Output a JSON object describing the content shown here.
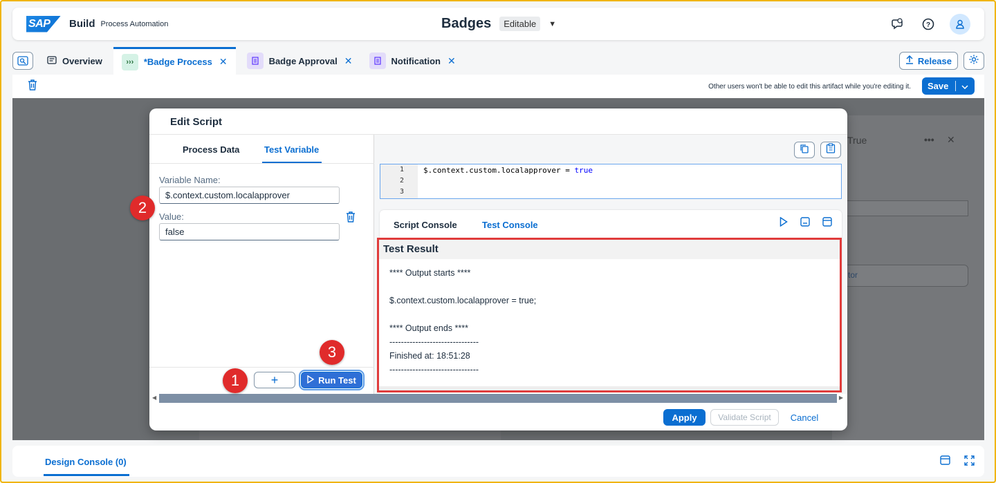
{
  "shell": {
    "logo": "SAP",
    "brand": "Build",
    "product": "Process Automation",
    "title": "Badges",
    "mode": "Editable"
  },
  "tabs": [
    {
      "label": "Overview"
    },
    {
      "label": "*Badge Process"
    },
    {
      "label": "Badge Approval"
    },
    {
      "label": "Notification"
    }
  ],
  "tabbar": {
    "release": "Release"
  },
  "toolbar": {
    "note": "Other users won't be able to edit this artifact while you're editing it.",
    "save": "Save"
  },
  "background": {
    "partial_true": "True",
    "partial_tor": "tor"
  },
  "dialog": {
    "title": "Edit Script",
    "left_tabs": [
      "Process Data",
      "Test Variable"
    ],
    "variable_name_label": "Variable Name:",
    "variable_name_value": "$.context.custom.localapprover",
    "value_label": "Value:",
    "value_value": "false",
    "run_test": "Run Test",
    "add_symbol": "+",
    "editor": {
      "line_numbers": [
        "1",
        "2",
        "3"
      ],
      "code_prefix": "$.context.custom.localapprover = ",
      "code_keyword": "true"
    },
    "console_tabs": [
      "Script Console",
      "Test Console"
    ],
    "test_result": {
      "heading": "Test Result",
      "lines": [
        "**** Output starts ****",
        "",
        "$.context.custom.localapprover = true;",
        "",
        "**** Output ends ****",
        "-------------------------------",
        "Finished at: 18:51:28",
        "-------------------------------"
      ]
    },
    "footer": {
      "apply": "Apply",
      "validate": "Validate Script",
      "cancel": "Cancel"
    }
  },
  "markers": [
    "1",
    "2",
    "3"
  ],
  "bottom": {
    "design_console": "Design Console (0)"
  },
  "colors": {
    "accent": "#0a6ed1",
    "highlight": "#e03c3c",
    "marker": "#e02b2b",
    "frame": "#f0b400"
  }
}
